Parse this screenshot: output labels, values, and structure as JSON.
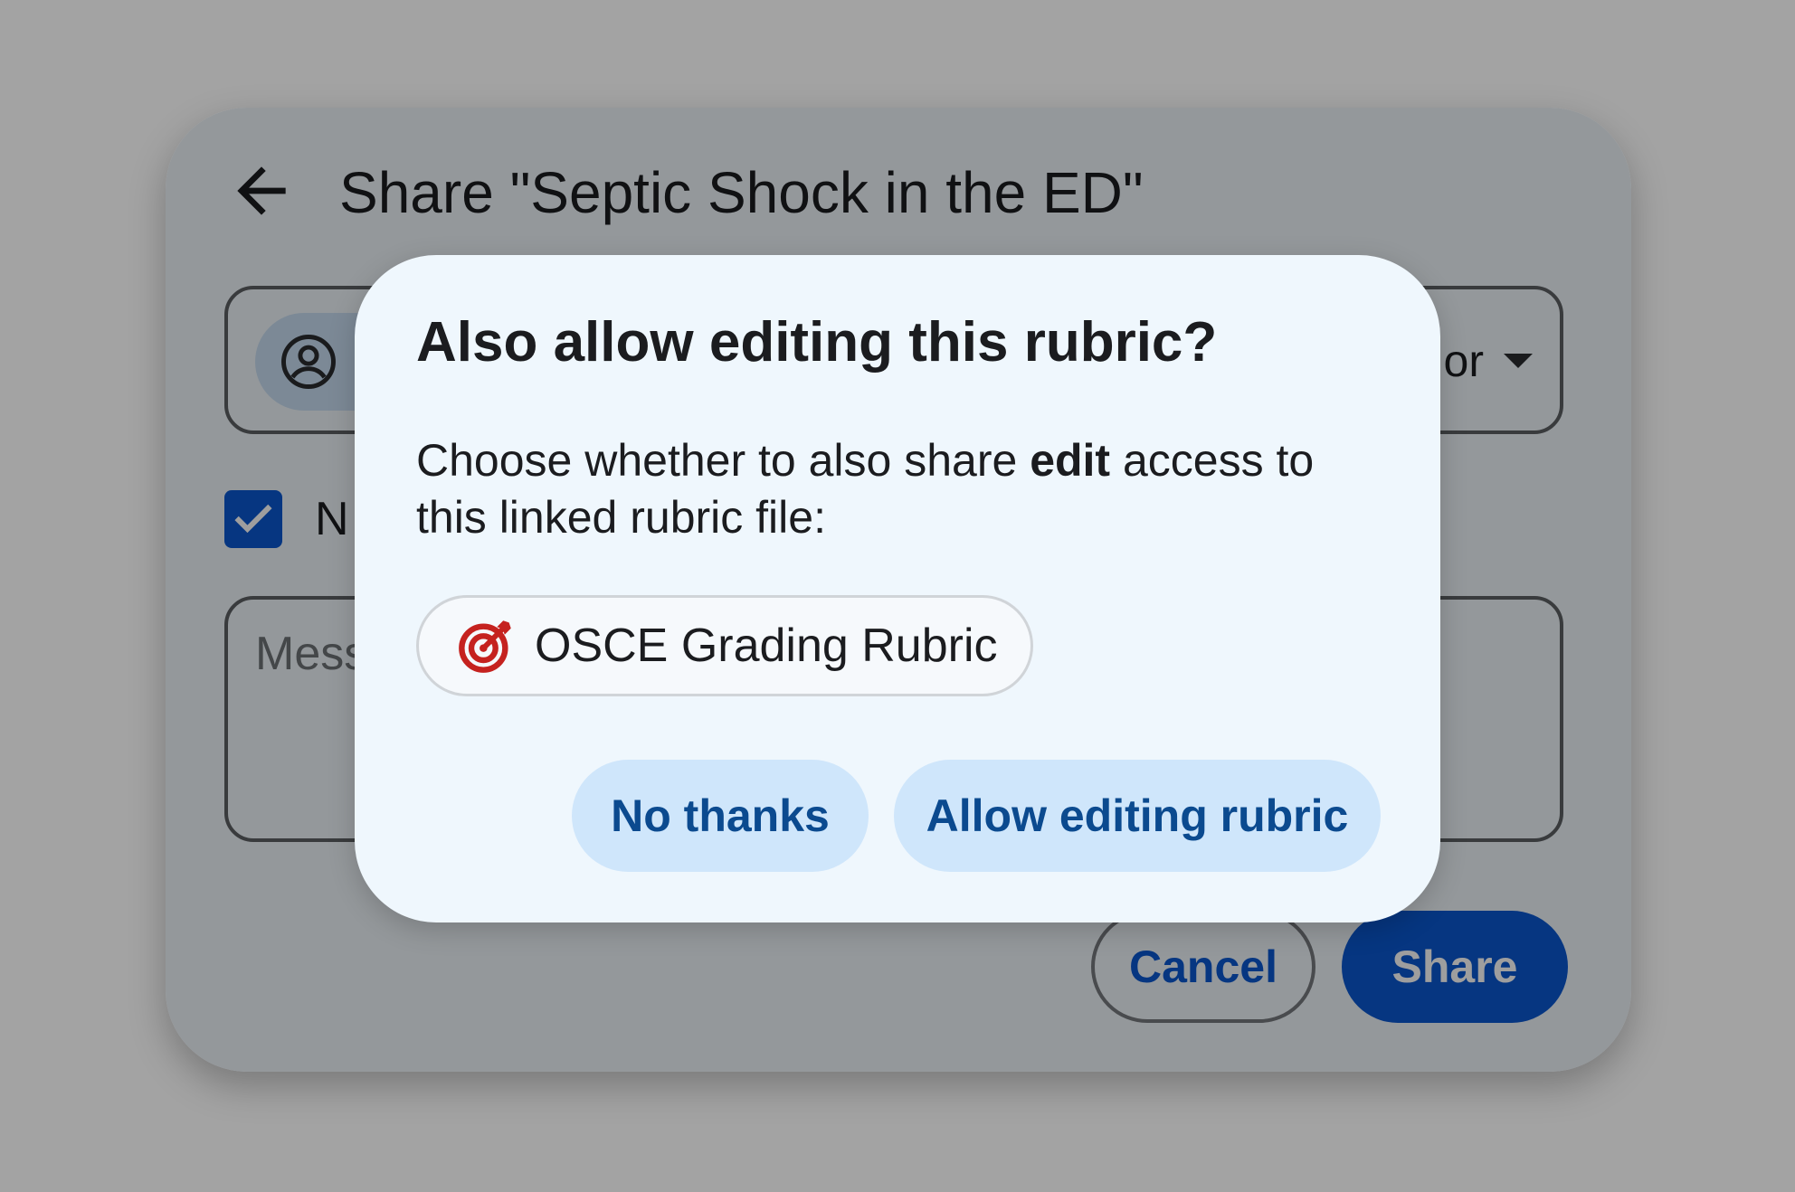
{
  "share_dialog": {
    "title": "Share \"Septic Shock in the ED\"",
    "role_selector": {
      "visible_text": "or"
    },
    "notify": {
      "visible_label": "N",
      "checked": true
    },
    "message": {
      "visible_placeholder": "Mess"
    },
    "cancel_label": "Cancel",
    "share_label": "Share"
  },
  "confirm_modal": {
    "title": "Also allow editing this rubric?",
    "body_prefix": "Choose whether to also share ",
    "body_emphasis": "edit",
    "body_suffix": " access to this linked rubric file:",
    "file_chip": {
      "label": "OSCE Grading Rubric",
      "icon": "target-icon",
      "icon_color": "#c5221f"
    },
    "no_thanks_label": "No thanks",
    "allow_label": "Allow editing rubric"
  },
  "colors": {
    "page_background": "#a3a3a3",
    "primary": "#0b57d0",
    "tonal_button": "#cfe6fb",
    "tonal_button_text": "#0b4a8f",
    "dialog_surface": "#eff7fd"
  }
}
